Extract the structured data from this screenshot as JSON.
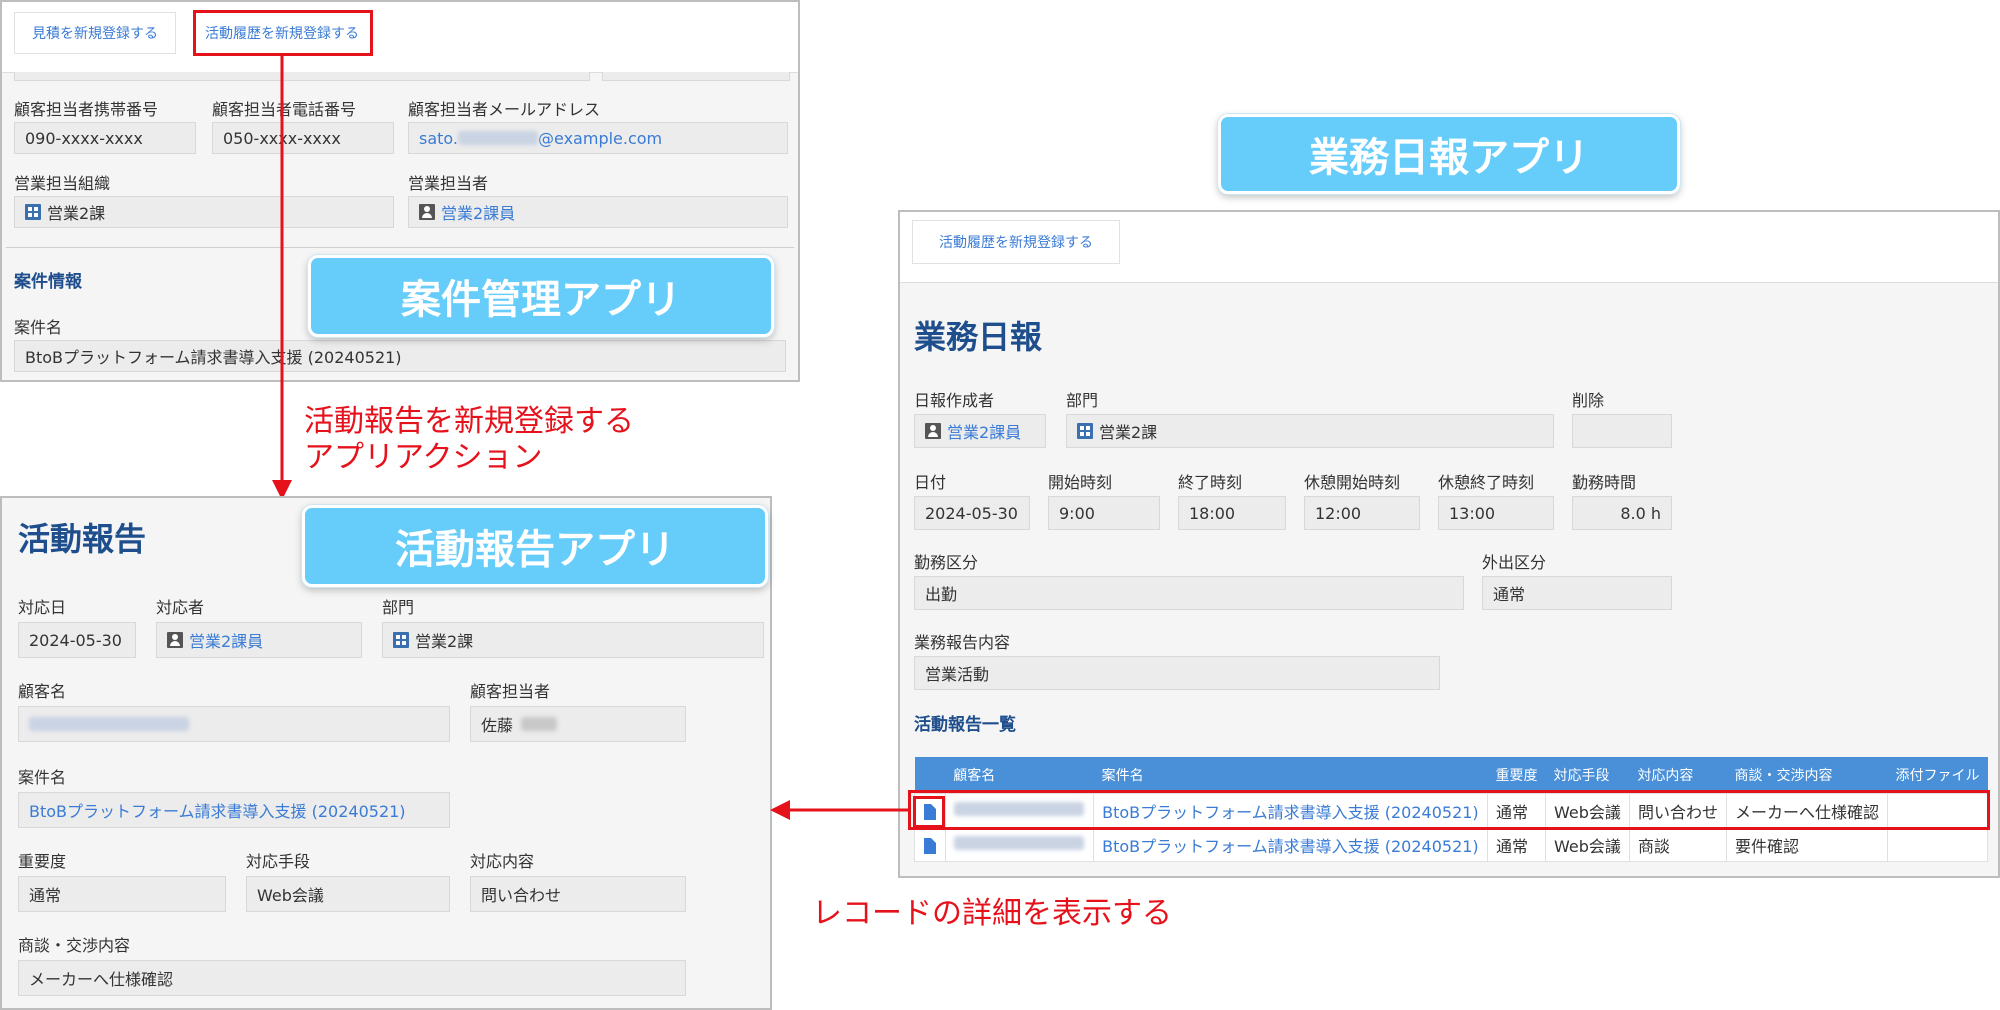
{
  "case_app": {
    "buttons": {
      "estimate": "見積を新規登録する",
      "activity": "活動履歴を新規登録する"
    },
    "labels": {
      "mobile": "顧客担当者携帯番号",
      "phone": "顧客担当者電話番号",
      "email": "顧客担当者メールアドレス",
      "org": "営業担当組織",
      "rep": "営業担当者",
      "case_name": "案件名"
    },
    "values": {
      "mobile": "090-xxxx-xxxx",
      "phone": "050-xxxx-xxxx",
      "email_prefix": "sato.",
      "email_suffix": "@example.com",
      "org": "営業2課",
      "rep": "営業2課員",
      "case_name": "BtoBプラットフォーム請求書導入支援 (20240521)"
    },
    "section": "案件情報",
    "badge": "案件管理アプリ"
  },
  "arrow_label_1": "活動報告を新規登録する",
  "arrow_label_2": "アプリアクション",
  "activity_app": {
    "title": "活動報告",
    "badge": "活動報告アプリ",
    "labels": {
      "date": "対応日",
      "person": "対応者",
      "dept": "部門",
      "customer": "顧客名",
      "contact": "顧客担当者",
      "case": "案件名",
      "importance": "重要度",
      "method": "対応手段",
      "content": "対応内容",
      "negotiation": "商談・交渉内容"
    },
    "values": {
      "date": "2024-05-30",
      "person": "営業2課員",
      "dept": "営業2課",
      "contact": "佐藤",
      "case": "BtoBプラットフォーム請求書導入支援 (20240521)",
      "importance": "通常",
      "method": "Web会議",
      "content": "問い合わせ",
      "negotiation": "メーカーへ仕様確認"
    }
  },
  "daily_app": {
    "badge": "業務日報アプリ",
    "button": "活動履歴を新規登録する",
    "title": "業務日報",
    "labels": {
      "author": "日報作成者",
      "dept": "部門",
      "delete": "削除",
      "date": "日付",
      "start": "開始時刻",
      "end": "終了時刻",
      "break_start": "休憩開始時刻",
      "break_end": "休憩終了時刻",
      "hours": "勤務時間",
      "work_type": "勤務区分",
      "outing": "外出区分",
      "report": "業務報告内容"
    },
    "values": {
      "author": "営業2課員",
      "dept": "営業2課",
      "date": "2024-05-30",
      "start": "9:00",
      "end": "18:00",
      "break_start": "12:00",
      "break_end": "13:00",
      "hours": "8.0 h",
      "work_type": "出勤",
      "outing": "通常",
      "report": "営業活動"
    },
    "list_title": "活動報告一覧",
    "table": {
      "headers": [
        "顧客名",
        "案件名",
        "重要度",
        "対応手段",
        "対応内容",
        "商談・交渉内容",
        "添付ファイル"
      ],
      "rows": [
        {
          "case": "BtoBプラットフォーム請求書導入支援 (20240521)",
          "importance": "通常",
          "method": "Web会議",
          "content": "問い合わせ",
          "negotiation": "メーカーへ仕様確認",
          "attachment": ""
        },
        {
          "case": "BtoBプラットフォーム請求書導入支援 (20240521)",
          "importance": "通常",
          "method": "Web会議",
          "content": "商談",
          "negotiation": "要件確認",
          "attachment": ""
        }
      ]
    }
  },
  "detail_label": "レコードの詳細を表示する",
  "colors": {
    "accent_red": "#e5121b",
    "badge_blue": "#66ccfa",
    "title_blue": "#1f4e8c",
    "link_blue": "#3a7bd5",
    "header_blue": "#4a90d9"
  }
}
